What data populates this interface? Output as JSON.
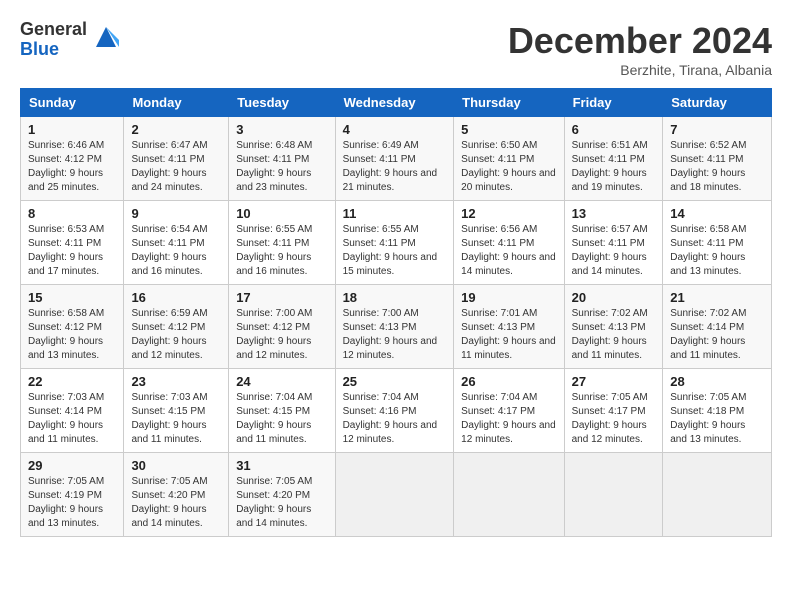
{
  "logo": {
    "general": "General",
    "blue": "Blue"
  },
  "header": {
    "month": "December 2024",
    "location": "Berzhite, Tirana, Albania"
  },
  "weekdays": [
    "Sunday",
    "Monday",
    "Tuesday",
    "Wednesday",
    "Thursday",
    "Friday",
    "Saturday"
  ],
  "weeks": [
    [
      {
        "day": "1",
        "sunrise": "6:46 AM",
        "sunset": "4:12 PM",
        "daylight": "9 hours and 25 minutes."
      },
      {
        "day": "2",
        "sunrise": "6:47 AM",
        "sunset": "4:11 PM",
        "daylight": "9 hours and 24 minutes."
      },
      {
        "day": "3",
        "sunrise": "6:48 AM",
        "sunset": "4:11 PM",
        "daylight": "9 hours and 23 minutes."
      },
      {
        "day": "4",
        "sunrise": "6:49 AM",
        "sunset": "4:11 PM",
        "daylight": "9 hours and 21 minutes."
      },
      {
        "day": "5",
        "sunrise": "6:50 AM",
        "sunset": "4:11 PM",
        "daylight": "9 hours and 20 minutes."
      },
      {
        "day": "6",
        "sunrise": "6:51 AM",
        "sunset": "4:11 PM",
        "daylight": "9 hours and 19 minutes."
      },
      {
        "day": "7",
        "sunrise": "6:52 AM",
        "sunset": "4:11 PM",
        "daylight": "9 hours and 18 minutes."
      }
    ],
    [
      {
        "day": "8",
        "sunrise": "6:53 AM",
        "sunset": "4:11 PM",
        "daylight": "9 hours and 17 minutes."
      },
      {
        "day": "9",
        "sunrise": "6:54 AM",
        "sunset": "4:11 PM",
        "daylight": "9 hours and 16 minutes."
      },
      {
        "day": "10",
        "sunrise": "6:55 AM",
        "sunset": "4:11 PM",
        "daylight": "9 hours and 16 minutes."
      },
      {
        "day": "11",
        "sunrise": "6:55 AM",
        "sunset": "4:11 PM",
        "daylight": "9 hours and 15 minutes."
      },
      {
        "day": "12",
        "sunrise": "6:56 AM",
        "sunset": "4:11 PM",
        "daylight": "9 hours and 14 minutes."
      },
      {
        "day": "13",
        "sunrise": "6:57 AM",
        "sunset": "4:11 PM",
        "daylight": "9 hours and 14 minutes."
      },
      {
        "day": "14",
        "sunrise": "6:58 AM",
        "sunset": "4:11 PM",
        "daylight": "9 hours and 13 minutes."
      }
    ],
    [
      {
        "day": "15",
        "sunrise": "6:58 AM",
        "sunset": "4:12 PM",
        "daylight": "9 hours and 13 minutes."
      },
      {
        "day": "16",
        "sunrise": "6:59 AM",
        "sunset": "4:12 PM",
        "daylight": "9 hours and 12 minutes."
      },
      {
        "day": "17",
        "sunrise": "7:00 AM",
        "sunset": "4:12 PM",
        "daylight": "9 hours and 12 minutes."
      },
      {
        "day": "18",
        "sunrise": "7:00 AM",
        "sunset": "4:13 PM",
        "daylight": "9 hours and 12 minutes."
      },
      {
        "day": "19",
        "sunrise": "7:01 AM",
        "sunset": "4:13 PM",
        "daylight": "9 hours and 11 minutes."
      },
      {
        "day": "20",
        "sunrise": "7:02 AM",
        "sunset": "4:13 PM",
        "daylight": "9 hours and 11 minutes."
      },
      {
        "day": "21",
        "sunrise": "7:02 AM",
        "sunset": "4:14 PM",
        "daylight": "9 hours and 11 minutes."
      }
    ],
    [
      {
        "day": "22",
        "sunrise": "7:03 AM",
        "sunset": "4:14 PM",
        "daylight": "9 hours and 11 minutes."
      },
      {
        "day": "23",
        "sunrise": "7:03 AM",
        "sunset": "4:15 PM",
        "daylight": "9 hours and 11 minutes."
      },
      {
        "day": "24",
        "sunrise": "7:04 AM",
        "sunset": "4:15 PM",
        "daylight": "9 hours and 11 minutes."
      },
      {
        "day": "25",
        "sunrise": "7:04 AM",
        "sunset": "4:16 PM",
        "daylight": "9 hours and 12 minutes."
      },
      {
        "day": "26",
        "sunrise": "7:04 AM",
        "sunset": "4:17 PM",
        "daylight": "9 hours and 12 minutes."
      },
      {
        "day": "27",
        "sunrise": "7:05 AM",
        "sunset": "4:17 PM",
        "daylight": "9 hours and 12 minutes."
      },
      {
        "day": "28",
        "sunrise": "7:05 AM",
        "sunset": "4:18 PM",
        "daylight": "9 hours and 13 minutes."
      }
    ],
    [
      {
        "day": "29",
        "sunrise": "7:05 AM",
        "sunset": "4:19 PM",
        "daylight": "9 hours and 13 minutes."
      },
      {
        "day": "30",
        "sunrise": "7:05 AM",
        "sunset": "4:20 PM",
        "daylight": "9 hours and 14 minutes."
      },
      {
        "day": "31",
        "sunrise": "7:05 AM",
        "sunset": "4:20 PM",
        "daylight": "9 hours and 14 minutes."
      },
      null,
      null,
      null,
      null
    ]
  ]
}
